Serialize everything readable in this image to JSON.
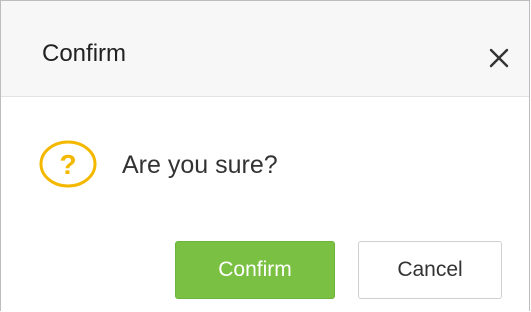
{
  "dialog": {
    "title": "Confirm",
    "close_icon": "close-icon",
    "message": "Are you sure?",
    "message_icon": "question-icon",
    "confirm_label": "Confirm",
    "cancel_label": "Cancel"
  },
  "colors": {
    "header_background": "#f7f7f7",
    "icon_accent": "#f5b800",
    "confirm_button": "#7ac143",
    "cancel_button_border": "#cfcfcf"
  }
}
